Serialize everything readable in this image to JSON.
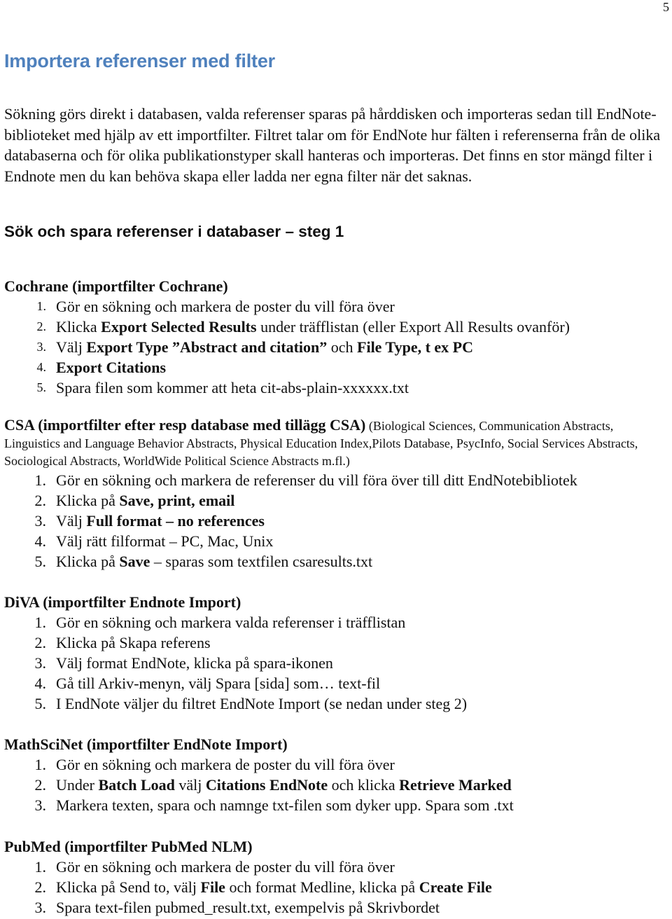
{
  "page_number": "5",
  "heading": "Importera referenser med filter",
  "intro": "Sökning görs direkt i databasen, valda referenser sparas på hårddisken och importeras sedan till EndNote-biblioteket med hjälp av ett importfilter. Filtret talar om för EndNote hur fälten i referenserna från de olika databaserna och för olika publikationstyper skall hanteras och importeras. Det finns en stor mängd filter i Endnote men du kan behöva skapa eller ladda ner egna filter när det saknas.",
  "subheading": "Sök och spara referenser i databaser – steg 1",
  "sections": {
    "cochrane": {
      "title": "Cochrane (importfilter Cochrane)",
      "steps": [
        {
          "num": "1.",
          "parts": [
            {
              "t": "Gör en sökning och markera de poster du vill föra över",
              "b": false
            }
          ]
        },
        {
          "num": "2.",
          "parts": [
            {
              "t": "Klicka ",
              "b": false
            },
            {
              "t": "Export Selected Results",
              "b": true
            },
            {
              "t": " under träfflistan (eller Export All Results ovanför)",
              "b": false
            }
          ]
        },
        {
          "num": "3.",
          "parts": [
            {
              "t": "Välj ",
              "b": false
            },
            {
              "t": "Export Type ”Abstract and citation”",
              "b": true
            },
            {
              "t": " och ",
              "b": false
            },
            {
              "t": "File Type, t ex PC",
              "b": true
            }
          ]
        },
        {
          "num": "4.",
          "parts": [
            {
              "t": "Export Citations",
              "b": true
            }
          ]
        },
        {
          "num": "5.",
          "parts": [
            {
              "t": "Spara filen som kommer att heta cit-abs-plain-xxxxxx.txt",
              "b": false
            }
          ]
        }
      ]
    },
    "csa": {
      "title": "CSA (importfilter efter resp database med tillägg CSA)",
      "note": " (Biological Sciences, Communication Abstracts, Linguistics and Language Behavior Abstracts, Physical Education Index,Pilots Database, PsycInfo, Social Services Abstracts, Sociological Abstracts, WorldWide Political Science Abstracts m.fl.)",
      "steps": [
        {
          "num": "1.",
          "parts": [
            {
              "t": "Gör en sökning och markera de referenser du vill föra över till ditt EndNotebibliotek",
              "b": false
            }
          ]
        },
        {
          "num": "2.",
          "parts": [
            {
              "t": "Klicka på ",
              "b": false
            },
            {
              "t": "Save, print, email",
              "b": true
            }
          ]
        },
        {
          "num": "3.",
          "parts": [
            {
              "t": "Välj ",
              "b": false
            },
            {
              "t": "Full format – no references",
              "b": true
            }
          ]
        },
        {
          "num": "4.",
          "parts": [
            {
              "t": "Välj rätt filformat – PC, Mac, Unix",
              "b": false
            }
          ]
        },
        {
          "num": "5.",
          "parts": [
            {
              "t": "Klicka på ",
              "b": false
            },
            {
              "t": "Save",
              "b": true
            },
            {
              "t": " – sparas som textfilen csaresults.txt",
              "b": false
            }
          ]
        }
      ]
    },
    "diva": {
      "title": "DiVA (importfilter Endnote Import)",
      "steps": [
        {
          "num": "1.",
          "parts": [
            {
              "t": "Gör en sökning och markera valda referenser i träfflistan",
              "b": false
            }
          ]
        },
        {
          "num": "2.",
          "parts": [
            {
              "t": "Klicka på Skapa referens",
              "b": false
            }
          ]
        },
        {
          "num": "3.",
          "parts": [
            {
              "t": "Välj format EndNote, klicka på spara-ikonen",
              "b": false
            }
          ]
        },
        {
          "num": "4.",
          "parts": [
            {
              "t": "Gå till Arkiv-menyn, välj Spara [sida] som… text-fil",
              "b": false
            }
          ]
        },
        {
          "num": "5.",
          "parts": [
            {
              "t": "I EndNote väljer du filtret EndNote Import (se nedan under steg 2)",
              "b": false
            }
          ]
        }
      ]
    },
    "mathscinet": {
      "title": "MathSciNet (importfilter EndNote Import)",
      "steps": [
        {
          "num": "1.",
          "parts": [
            {
              "t": "Gör en sökning och markera de poster du vill föra över",
              "b": false
            }
          ]
        },
        {
          "num": "2.",
          "parts": [
            {
              "t": "Under ",
              "b": false
            },
            {
              "t": "Batch Load",
              "b": true
            },
            {
              "t": " välj ",
              "b": false
            },
            {
              "t": "Citations EndNote",
              "b": true
            },
            {
              "t": " och klicka ",
              "b": false
            },
            {
              "t": "Retrieve Marked",
              "b": true
            }
          ]
        },
        {
          "num": "3.",
          "parts": [
            {
              "t": "Markera texten, spara och namnge txt-filen som dyker upp. Spara som .txt",
              "b": false
            }
          ]
        }
      ]
    },
    "pubmed": {
      "title": "PubMed (importfilter PubMed NLM)",
      "steps": [
        {
          "num": "1.",
          "parts": [
            {
              "t": "Gör en sökning och markera de poster du vill föra över",
              "b": false
            }
          ]
        },
        {
          "num": "2.",
          "parts": [
            {
              "t": "Klicka på Send to, välj ",
              "b": false
            },
            {
              "t": "File",
              "b": true
            },
            {
              "t": " och format Medline, klicka på ",
              "b": false
            },
            {
              "t": "Create File",
              "b": true
            }
          ]
        },
        {
          "num": "3.",
          "parts": [
            {
              "t": "Spara text-filen pubmed_result.txt, exempelvis på Skrivbordet",
              "b": false
            }
          ]
        }
      ]
    }
  }
}
